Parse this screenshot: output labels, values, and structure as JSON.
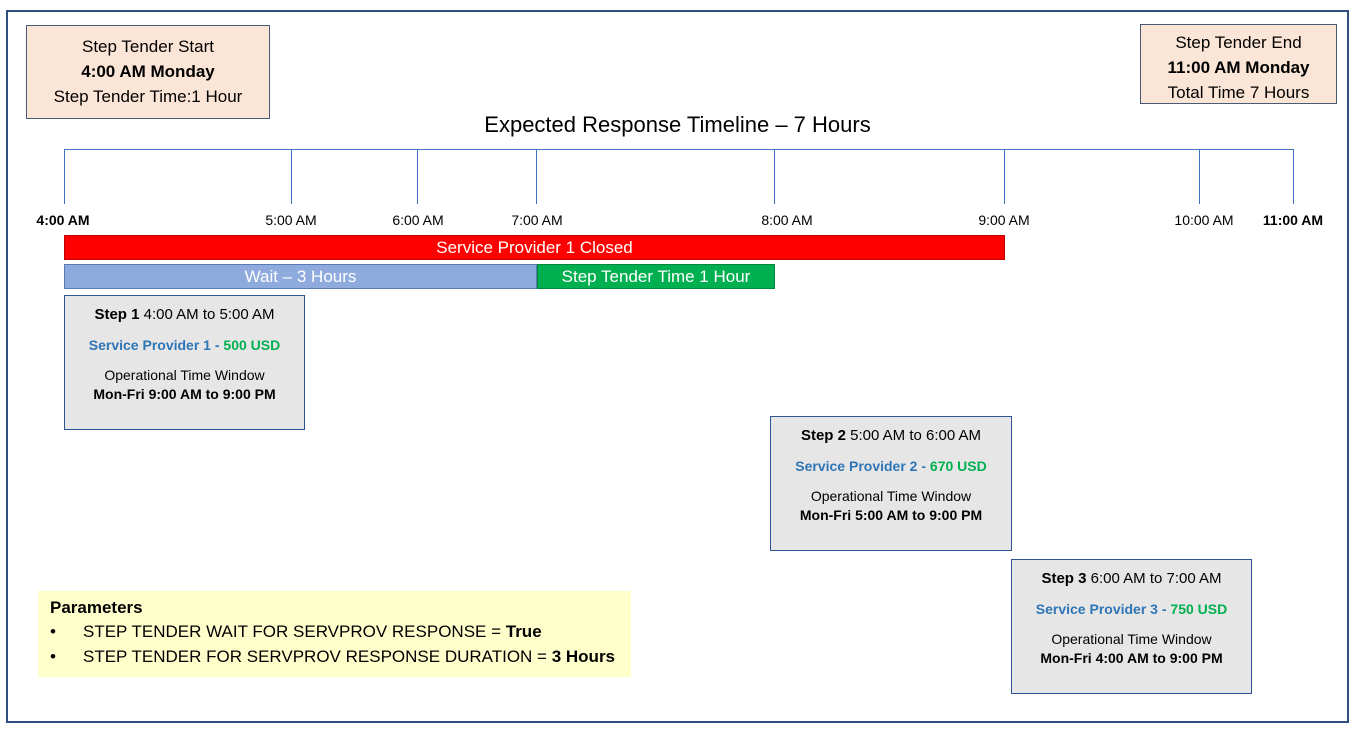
{
  "start_box": {
    "line1": "Step Tender Start",
    "line2": "4:00 AM Monday",
    "line3": "Step Tender Time:1 Hour"
  },
  "end_box": {
    "line1": "Step Tender End",
    "line2": "11:00 AM Monday",
    "line3": "Total Time 7 Hours"
  },
  "title": "Expected Response Timeline – 7 Hours",
  "ticks": [
    "4:00 AM",
    "5:00 AM",
    "6:00 AM",
    "7:00 AM",
    "8:00 AM",
    "9:00 AM",
    "10:00 AM",
    "11:00 AM"
  ],
  "bars": {
    "closed": "Service Provider 1 Closed",
    "wait": "Wait – 3 Hours",
    "tender": "Step Tender Time 1 Hour"
  },
  "steps": [
    {
      "label": "Step 1",
      "time": "4:00 AM to 5:00 AM",
      "provider": "Service Provider 1 - ",
      "price": "500 USD",
      "window_label": "Operational Time Window",
      "window": "Mon-Fri  9:00 AM to 9:00 PM"
    },
    {
      "label": "Step 2",
      "time": "5:00 AM to 6:00 AM",
      "provider": "Service Provider 2 - ",
      "price": "670 USD",
      "window_label": "Operational Time Window",
      "window": "Mon-Fri  5:00 AM to 9:00 PM"
    },
    {
      "label": "Step 3",
      "time": "6:00 AM to 7:00 AM",
      "provider": "Service Provider 3 - ",
      "price": "750 USD",
      "window_label": "Operational Time Window",
      "window": "Mon-Fri  4:00 AM to 9:00 PM"
    }
  ],
  "parameters": {
    "title": "Parameters",
    "items": [
      {
        "label": "STEP TENDER WAIT FOR SERVPROV RESPONSE = ",
        "value": "True"
      },
      {
        "label": "STEP TENDER FOR SERVPROV RESPONSE DURATION = ",
        "value": "3 Hours"
      }
    ]
  },
  "colors": {
    "closed": "#ff0000",
    "wait": "#8faadc",
    "tender": "#00b050",
    "provider": "#2e75b6",
    "price": "#00b050",
    "axis": "#4472c4"
  }
}
